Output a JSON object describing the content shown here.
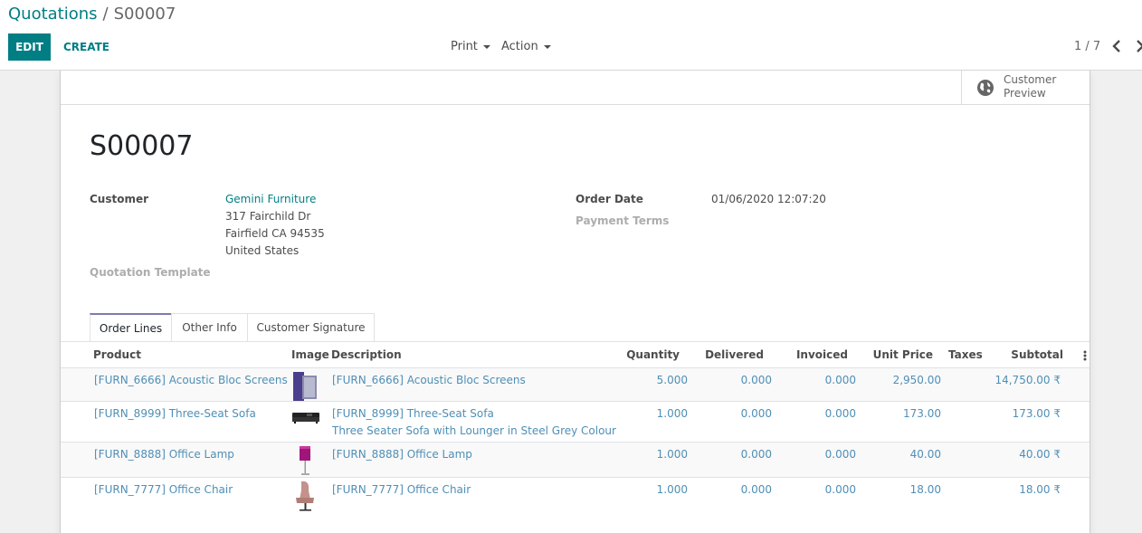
{
  "breadcrumb": {
    "parent": "Quotations",
    "separator": "/",
    "current": "S00007"
  },
  "toolbar": {
    "edit_label": "EDIT",
    "create_label": "CREATE",
    "print_label": "Print",
    "action_label": "Action"
  },
  "pager": {
    "value": "1 / 7"
  },
  "stat_button": {
    "label": "Customer Preview"
  },
  "record": {
    "name": "S00007",
    "customer_label": "Customer",
    "customer_name": "Gemini Furniture",
    "address_line1": "317 Fairchild Dr",
    "address_line2": "Fairfield CA 94535",
    "address_line3": "United States",
    "template_label": "Quotation Template",
    "order_date_label": "Order Date",
    "order_date": "01/06/2020 12:07:20",
    "payment_terms_label": "Payment Terms"
  },
  "tabs": [
    "Order Lines",
    "Other Info",
    "Customer Signature"
  ],
  "table": {
    "headers": {
      "product": "Product",
      "image": "Image",
      "description": "Description",
      "quantity": "Quantity",
      "delivered": "Delivered",
      "invoiced": "Invoiced",
      "unit_price": "Unit Price",
      "taxes": "Taxes",
      "subtotal": "Subtotal"
    },
    "rows": [
      {
        "product": "[FURN_6666] Acoustic Bloc Screens",
        "description": "[FURN_6666] Acoustic Bloc Screens",
        "description_note": "",
        "quantity": "5.000",
        "delivered": "0.000",
        "invoiced": "0.000",
        "unit_price": "2,950.00",
        "taxes": "",
        "subtotal": "14,750.00 ₹",
        "image_icon": "screens-image"
      },
      {
        "product": "[FURN_8999] Three-Seat Sofa",
        "description": "[FURN_8999] Three-Seat Sofa",
        "description_note": "Three Seater Sofa with Lounger in Steel Grey Colour",
        "quantity": "1.000",
        "delivered": "0.000",
        "invoiced": "0.000",
        "unit_price": "173.00",
        "taxes": "",
        "subtotal": "173.00 ₹",
        "image_icon": "sofa-image"
      },
      {
        "product": "[FURN_8888] Office Lamp",
        "description": "[FURN_8888] Office Lamp",
        "description_note": "",
        "quantity": "1.000",
        "delivered": "0.000",
        "invoiced": "0.000",
        "unit_price": "40.00",
        "taxes": "",
        "subtotal": "40.00 ₹",
        "image_icon": "lamp-image"
      },
      {
        "product": "[FURN_7777] Office Chair",
        "description": "[FURN_7777] Office Chair",
        "description_note": "",
        "quantity": "1.000",
        "delivered": "0.000",
        "invoiced": "0.000",
        "unit_price": "18.00",
        "taxes": "",
        "subtotal": "18.00 ₹",
        "image_icon": "chair-image"
      }
    ]
  },
  "colors": {
    "brand": "#017e84",
    "link": "#4f8fb6",
    "tab_accent": "#7c7bad"
  }
}
